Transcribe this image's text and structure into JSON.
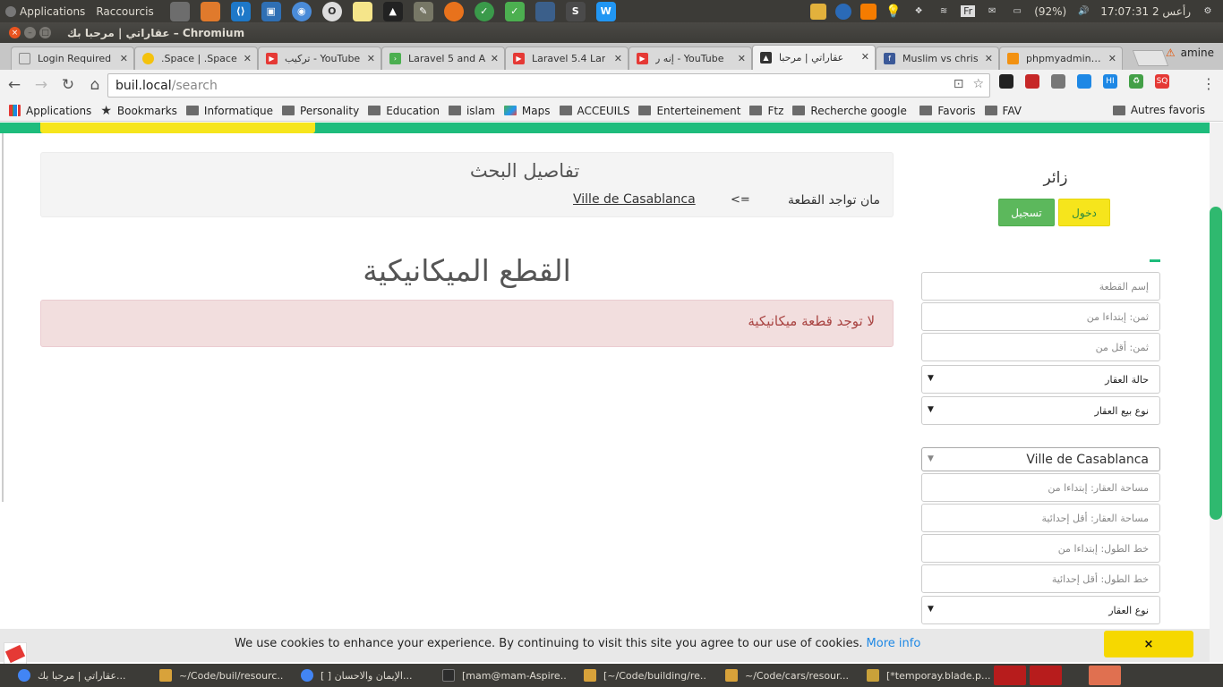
{
  "system_panel": {
    "applications": "Applications",
    "shortcuts": "Raccourcis",
    "battery": "(92%)",
    "clock": "17:07:31 2 رأعس",
    "keyboard": "Fr",
    "user": "amine"
  },
  "window": {
    "title": "عقاراتي | مرحبا بك – Chromium"
  },
  "tabs": [
    {
      "label": "Login Required",
      "icon_color": "#888888"
    },
    {
      "label": ".Space | .Space",
      "icon_color": "#f4c20d"
    },
    {
      "label": "تركيب - YouTube",
      "icon_color": "#e53935"
    },
    {
      "label": "Laravel 5 and A",
      "icon_color": "#4caf50"
    },
    {
      "label": "Laravel 5.4 Lar",
      "icon_color": "#e53935"
    },
    {
      "label": "إنه ر - YouTube",
      "icon_color": "#e53935"
    },
    {
      "label": "عقاراتي | مرحبا",
      "icon_color": "#333333",
      "active": true
    },
    {
      "label": "Muslim vs chris",
      "icon_color": "#3b5998"
    },
    {
      "label": "phpmyadmin.loc",
      "icon_color": "#f29111"
    }
  ],
  "toolbar": {
    "url_host": "buil.local",
    "url_path": "/search"
  },
  "bookmarks": [
    {
      "label": "Applications",
      "icon": "apps-icon"
    },
    {
      "label": "Bookmarks",
      "icon": "star-icon"
    },
    {
      "label": "Informatique",
      "icon": "folder-icon"
    },
    {
      "label": "Personality",
      "icon": "folder-icon"
    },
    {
      "label": "Education",
      "icon": "folder-icon"
    },
    {
      "label": "islam",
      "icon": "folder-icon"
    },
    {
      "label": "Maps",
      "icon": "maps-icon"
    },
    {
      "label": "ACCEUILS",
      "icon": "folder-icon"
    },
    {
      "label": "Enterteinement",
      "icon": "folder-icon"
    },
    {
      "label": "Ftz",
      "icon": "folder-icon"
    },
    {
      "label": "Recherche google a tr",
      "icon": "folder-icon"
    },
    {
      "label": "Favoris",
      "icon": "folder-icon"
    },
    {
      "label": "FAV",
      "icon": "folder-icon"
    }
  ],
  "bookmarks_other": "Autres favoris",
  "search_details": {
    "title": "تفاصيل البحث",
    "location_label": "مان تواجد القطعة",
    "arrow": "<=",
    "city": "Ville de Casablanca"
  },
  "main": {
    "heading": "القطع الميكانيكية",
    "alert": "لا توجد قطعة ميكانيكية"
  },
  "sidebar": {
    "visitor": "زائر",
    "login": "دخول",
    "register": "تسجيل",
    "fields": [
      {
        "placeholder": "إسم القطعة"
      },
      {
        "placeholder": "ثمن: إبتداءا من"
      },
      {
        "placeholder": "ثمن: أقل من"
      }
    ],
    "selects_top": [
      {
        "label": "حالة العقار"
      },
      {
        "label": "نوع بيع العقار"
      }
    ],
    "city_select": "Ville de Casablanca",
    "fields_bottom": [
      {
        "placeholder": "مساحة العقار: إبتداءا من"
      },
      {
        "placeholder": "مساحة العقار: أقل إحدائية"
      },
      {
        "placeholder": "خط الطول: إبتداءا من"
      },
      {
        "placeholder": "خط الطول: أقل إحدائية"
      }
    ],
    "select_bottom": {
      "label": "نوع العقار"
    }
  },
  "cookie": {
    "text": "We use cookies to enhance your experience. By continuing to visit this site you agree to our use of cookies.",
    "more": "More info",
    "dismiss": "×"
  },
  "taskbar": [
    {
      "label": "عقاراتي | مرحبا بك...",
      "color": "#4285f4"
    },
    {
      "label": "~/Code/buil/resourc...",
      "color": "#d8a23a"
    },
    {
      "label": "[ ] الإيمان والاحسان...",
      "color": "#4285f4"
    },
    {
      "label": "[mam@mam-Aspire...",
      "color": "#2c2c2c"
    },
    {
      "label": "[~/Code/building/re...",
      "color": "#d8a23a"
    },
    {
      "label": "~/Code/cars/resour...",
      "color": "#d8a23a"
    },
    {
      "label": "[*temporay.blade.p...",
      "color": "#c9a13a"
    }
  ]
}
